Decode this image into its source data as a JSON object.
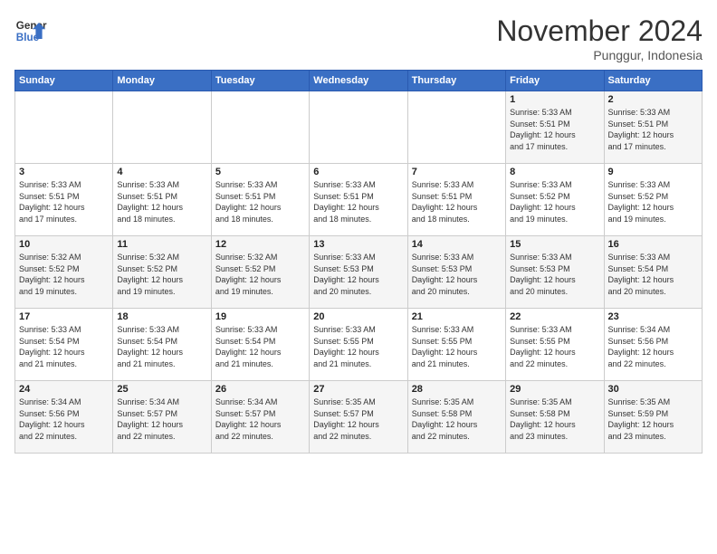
{
  "header": {
    "logo_line1": "General",
    "logo_line2": "Blue",
    "month_title": "November 2024",
    "location": "Punggur, Indonesia"
  },
  "days_of_week": [
    "Sunday",
    "Monday",
    "Tuesday",
    "Wednesday",
    "Thursday",
    "Friday",
    "Saturday"
  ],
  "weeks": [
    [
      {
        "day": "",
        "info": ""
      },
      {
        "day": "",
        "info": ""
      },
      {
        "day": "",
        "info": ""
      },
      {
        "day": "",
        "info": ""
      },
      {
        "day": "",
        "info": ""
      },
      {
        "day": "1",
        "info": "Sunrise: 5:33 AM\nSunset: 5:51 PM\nDaylight: 12 hours\nand 17 minutes."
      },
      {
        "day": "2",
        "info": "Sunrise: 5:33 AM\nSunset: 5:51 PM\nDaylight: 12 hours\nand 17 minutes."
      }
    ],
    [
      {
        "day": "3",
        "info": "Sunrise: 5:33 AM\nSunset: 5:51 PM\nDaylight: 12 hours\nand 17 minutes."
      },
      {
        "day": "4",
        "info": "Sunrise: 5:33 AM\nSunset: 5:51 PM\nDaylight: 12 hours\nand 18 minutes."
      },
      {
        "day": "5",
        "info": "Sunrise: 5:33 AM\nSunset: 5:51 PM\nDaylight: 12 hours\nand 18 minutes."
      },
      {
        "day": "6",
        "info": "Sunrise: 5:33 AM\nSunset: 5:51 PM\nDaylight: 12 hours\nand 18 minutes."
      },
      {
        "day": "7",
        "info": "Sunrise: 5:33 AM\nSunset: 5:51 PM\nDaylight: 12 hours\nand 18 minutes."
      },
      {
        "day": "8",
        "info": "Sunrise: 5:33 AM\nSunset: 5:52 PM\nDaylight: 12 hours\nand 19 minutes."
      },
      {
        "day": "9",
        "info": "Sunrise: 5:33 AM\nSunset: 5:52 PM\nDaylight: 12 hours\nand 19 minutes."
      }
    ],
    [
      {
        "day": "10",
        "info": "Sunrise: 5:32 AM\nSunset: 5:52 PM\nDaylight: 12 hours\nand 19 minutes."
      },
      {
        "day": "11",
        "info": "Sunrise: 5:32 AM\nSunset: 5:52 PM\nDaylight: 12 hours\nand 19 minutes."
      },
      {
        "day": "12",
        "info": "Sunrise: 5:32 AM\nSunset: 5:52 PM\nDaylight: 12 hours\nand 19 minutes."
      },
      {
        "day": "13",
        "info": "Sunrise: 5:33 AM\nSunset: 5:53 PM\nDaylight: 12 hours\nand 20 minutes."
      },
      {
        "day": "14",
        "info": "Sunrise: 5:33 AM\nSunset: 5:53 PM\nDaylight: 12 hours\nand 20 minutes."
      },
      {
        "day": "15",
        "info": "Sunrise: 5:33 AM\nSunset: 5:53 PM\nDaylight: 12 hours\nand 20 minutes."
      },
      {
        "day": "16",
        "info": "Sunrise: 5:33 AM\nSunset: 5:54 PM\nDaylight: 12 hours\nand 20 minutes."
      }
    ],
    [
      {
        "day": "17",
        "info": "Sunrise: 5:33 AM\nSunset: 5:54 PM\nDaylight: 12 hours\nand 21 minutes."
      },
      {
        "day": "18",
        "info": "Sunrise: 5:33 AM\nSunset: 5:54 PM\nDaylight: 12 hours\nand 21 minutes."
      },
      {
        "day": "19",
        "info": "Sunrise: 5:33 AM\nSunset: 5:54 PM\nDaylight: 12 hours\nand 21 minutes."
      },
      {
        "day": "20",
        "info": "Sunrise: 5:33 AM\nSunset: 5:55 PM\nDaylight: 12 hours\nand 21 minutes."
      },
      {
        "day": "21",
        "info": "Sunrise: 5:33 AM\nSunset: 5:55 PM\nDaylight: 12 hours\nand 21 minutes."
      },
      {
        "day": "22",
        "info": "Sunrise: 5:33 AM\nSunset: 5:55 PM\nDaylight: 12 hours\nand 22 minutes."
      },
      {
        "day": "23",
        "info": "Sunrise: 5:34 AM\nSunset: 5:56 PM\nDaylight: 12 hours\nand 22 minutes."
      }
    ],
    [
      {
        "day": "24",
        "info": "Sunrise: 5:34 AM\nSunset: 5:56 PM\nDaylight: 12 hours\nand 22 minutes."
      },
      {
        "day": "25",
        "info": "Sunrise: 5:34 AM\nSunset: 5:57 PM\nDaylight: 12 hours\nand 22 minutes."
      },
      {
        "day": "26",
        "info": "Sunrise: 5:34 AM\nSunset: 5:57 PM\nDaylight: 12 hours\nand 22 minutes."
      },
      {
        "day": "27",
        "info": "Sunrise: 5:35 AM\nSunset: 5:57 PM\nDaylight: 12 hours\nand 22 minutes."
      },
      {
        "day": "28",
        "info": "Sunrise: 5:35 AM\nSunset: 5:58 PM\nDaylight: 12 hours\nand 22 minutes."
      },
      {
        "day": "29",
        "info": "Sunrise: 5:35 AM\nSunset: 5:58 PM\nDaylight: 12 hours\nand 23 minutes."
      },
      {
        "day": "30",
        "info": "Sunrise: 5:35 AM\nSunset: 5:59 PM\nDaylight: 12 hours\nand 23 minutes."
      }
    ]
  ]
}
